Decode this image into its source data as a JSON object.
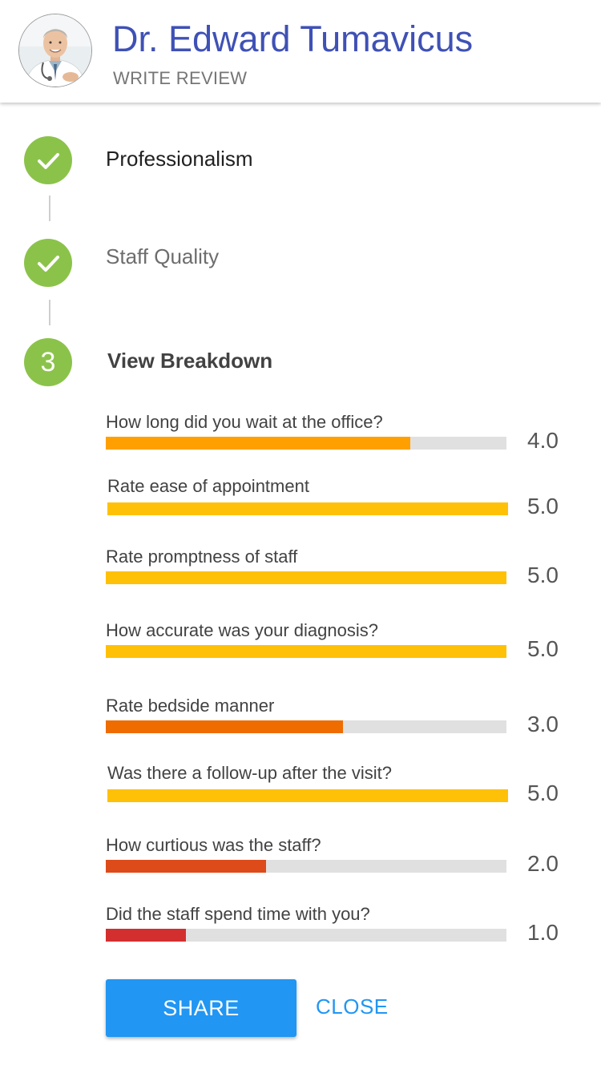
{
  "header": {
    "doctor_name": "Dr. Edward Tumavicus",
    "subtitle": "WRITE REVIEW"
  },
  "steps": [
    {
      "label": "Professionalism",
      "status": "completed",
      "icon": "check-icon"
    },
    {
      "label": "Staff Quality",
      "status": "completed",
      "icon": "check-icon"
    },
    {
      "number": "3",
      "label": "View Breakdown",
      "status": "active"
    }
  ],
  "ratings": [
    {
      "label": "How long did you wait at the office?",
      "value": "4.0",
      "fraction": 0.76,
      "color": "#ffa000"
    },
    {
      "label": "Rate ease of appointment",
      "value": "5.0",
      "fraction": 1.0,
      "color": "#ffc107"
    },
    {
      "label": "Rate promptness of staff",
      "value": "5.0",
      "fraction": 1.0,
      "color": "#ffc107"
    },
    {
      "label": "How accurate was your diagnosis?",
      "value": "5.0",
      "fraction": 1.0,
      "color": "#ffc107"
    },
    {
      "label": "Rate bedside manner",
      "value": "3.0",
      "fraction": 0.592,
      "color": "#ef6c00"
    },
    {
      "label": "Was there a follow-up after the visit?",
      "value": "5.0",
      "fraction": 1.0,
      "color": "#ffc107"
    },
    {
      "label": "How curtious was the staff?",
      "value": "2.0",
      "fraction": 0.4,
      "color": "#dd4b1a"
    },
    {
      "label": "Did the staff spend time with you?",
      "value": "1.0",
      "fraction": 0.2,
      "color": "#d32f2f"
    }
  ],
  "actions": {
    "share_label": "SHARE",
    "close_label": "CLOSE"
  },
  "colors": {
    "accent": "#3f51b5",
    "step_complete": "#8bc34a",
    "button": "#2196f3",
    "bar_track": "#e0e0e0"
  }
}
